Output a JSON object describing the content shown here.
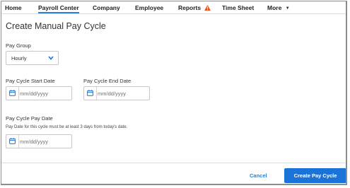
{
  "nav": {
    "items": [
      {
        "label": "Home"
      },
      {
        "label": "Payroll Center"
      },
      {
        "label": "Company"
      },
      {
        "label": "Employee"
      },
      {
        "label": "Reports",
        "icon": "warning-icon"
      },
      {
        "label": "Time Sheet"
      },
      {
        "label": "More",
        "icon": "caret-down-icon"
      }
    ],
    "active": "Payroll Center",
    "accent_color": "#2d7fd6",
    "warning_color": "#e8531f"
  },
  "page": {
    "title": "Create Manual Pay Cycle"
  },
  "form": {
    "pay_group": {
      "label": "Pay Group",
      "value": "Hourly"
    },
    "start_date": {
      "label": "Pay Cycle Start Date",
      "placeholder": "mm/dd/yyyy"
    },
    "end_date": {
      "label": "Pay Cycle End Date",
      "placeholder": "mm/dd/yyyy"
    },
    "pay_date": {
      "label": "Pay Cycle Pay Date",
      "help": "Pay Date for this cycle must be at least 3 days from today's date.",
      "placeholder": "mm/dd/yyyy"
    }
  },
  "footer": {
    "cancel_label": "Cancel",
    "submit_label": "Create Pay Cycle",
    "primary_color": "#1a73d8"
  }
}
